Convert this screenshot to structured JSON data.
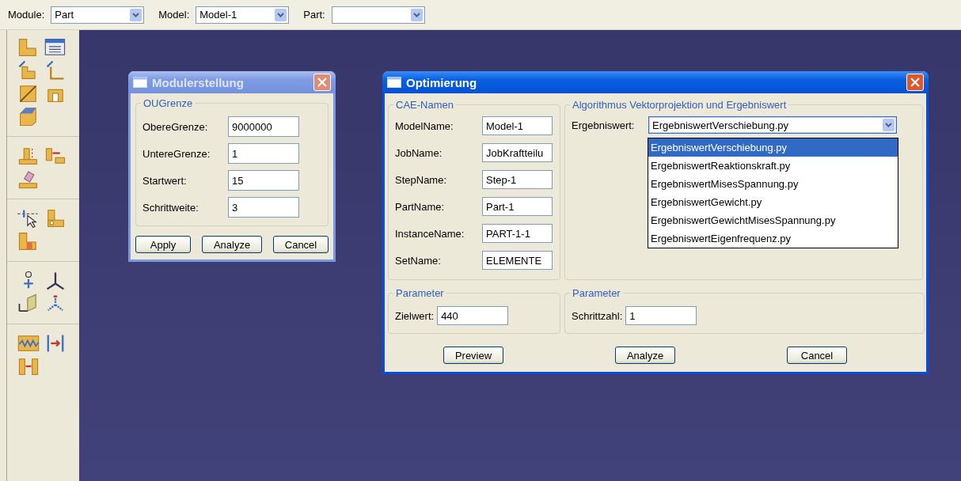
{
  "top_bar": {
    "fields": [
      {
        "label": "Module:",
        "value": "Part"
      },
      {
        "label": "Model:",
        "value": "Model-1"
      },
      {
        "label": "Part:"
      }
    ]
  },
  "modul_dialog": {
    "title": "Modulerstellung",
    "active": false,
    "group": {
      "title": "OUGrenze",
      "fields": [
        {
          "label": "ObereGrenze:",
          "value": "9000000"
        },
        {
          "label": "UntereGrenze:",
          "value": "1"
        },
        {
          "label": "Startwert:",
          "value": "15"
        },
        {
          "label": "Schrittweite:",
          "value": "3"
        }
      ]
    },
    "buttons": [
      "Apply",
      "Analyze",
      "Cancel"
    ]
  },
  "opt_dialog": {
    "title": "Optimierung",
    "active": true,
    "cae_group": {
      "title": "CAE-Namen",
      "fields": [
        {
          "label": "ModelName:",
          "value": "Model-1"
        },
        {
          "label": "JobName:",
          "value": "JobKraftteilu"
        },
        {
          "label": "StepName:",
          "value": "Step-1"
        },
        {
          "label": "PartName:",
          "value": "Part-1"
        },
        {
          "label": "InstanceName:",
          "value": "PART-1-1"
        },
        {
          "label": "SetName:",
          "value": "ELEMENTE"
        }
      ]
    },
    "algorithm_group": {
      "title": "Algorithmus Vektorprojektion und Ergebniswert",
      "label": "Ergebniswert:",
      "value": "ErgebniswertVerschiebung.py",
      "expanded": true,
      "options": [
        {
          "label": "ErgebniswertVerschiebung.py",
          "selected": true
        },
        {
          "label": "ErgebniswertReaktionskraft.py",
          "selected": false
        },
        {
          "label": "ErgebniswertMisesSpannung.py",
          "selected": false
        },
        {
          "label": "ErgebniswertGewicht.py",
          "selected": false
        },
        {
          "label": "ErgebniswertGewichtMisesSpannung.py",
          "selected": false
        },
        {
          "label": "ErgebniswertEigenfrequenz.py",
          "selected": false
        }
      ]
    },
    "parameter_groups": [
      {
        "title": "Parameter",
        "label": "Zielwert:",
        "value": "440"
      },
      {
        "title": "Parameter",
        "label": "Schrittzahl:",
        "value": "1"
      }
    ],
    "buttons": [
      "Preview",
      "Analyze",
      "Cancel"
    ]
  }
}
